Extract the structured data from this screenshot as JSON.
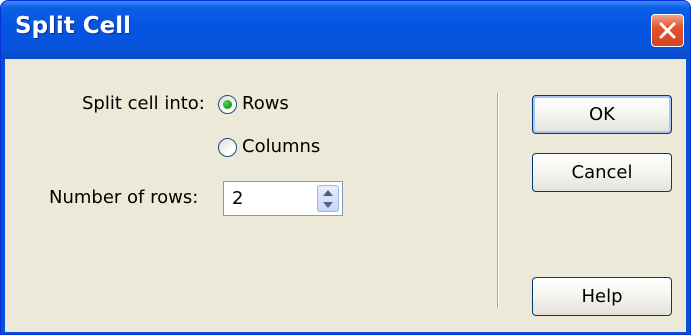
{
  "window": {
    "title": "Split Cell"
  },
  "form": {
    "split_label": "Split cell into:",
    "options": [
      {
        "label": "Rows",
        "selected": true
      },
      {
        "label": "Columns",
        "selected": false
      }
    ],
    "count_label": "Number of rows:",
    "count_value": "2"
  },
  "buttons": {
    "ok": "OK",
    "cancel": "Cancel",
    "help": "Help"
  },
  "icons": {
    "close": "close-icon",
    "spin_up": "chevron-up-icon",
    "spin_down": "chevron-down-icon"
  },
  "colors": {
    "titlebar": "#0554e0",
    "client": "#ece9d8",
    "close": "#e2542b",
    "radio_dot": "#21a121"
  }
}
